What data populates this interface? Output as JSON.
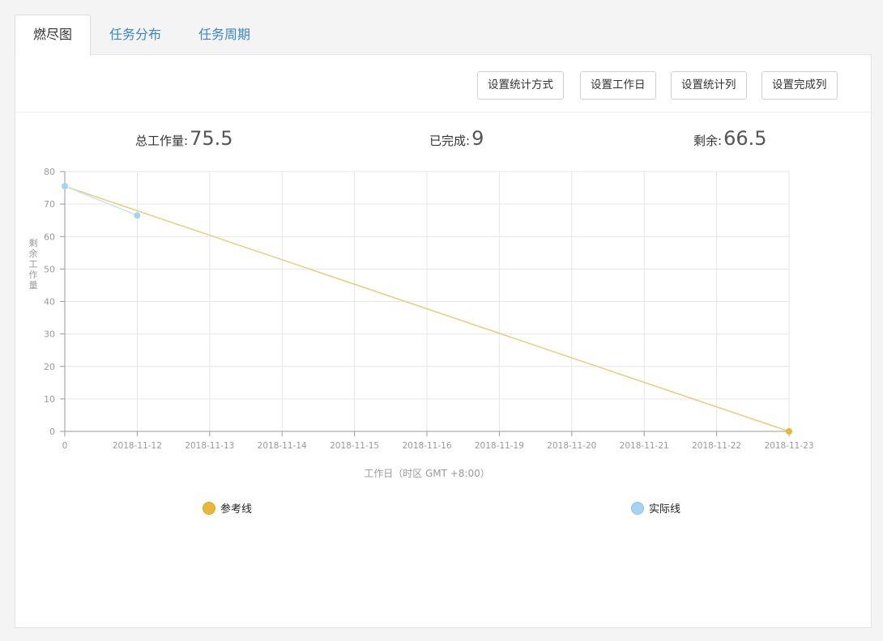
{
  "tabs": [
    {
      "label": "燃尽图",
      "active": true
    },
    {
      "label": "任务分布",
      "active": false
    },
    {
      "label": "任务周期",
      "active": false
    }
  ],
  "toolbar": {
    "stat_method": "设置统计方式",
    "workdays": "设置工作日",
    "stat_column": "设置统计列",
    "done_column": "设置完成列"
  },
  "summary": {
    "total_label": "总工作量:",
    "total_value": "75.5",
    "done_label": "已完成:",
    "done_value": "9",
    "remain_label": "剩余:",
    "remain_value": "66.5"
  },
  "colors": {
    "reference": "#e8cc7a",
    "reference_marker": "#e6b93a",
    "actual": "#a8d2ef",
    "actual_line": "#c9e3f5",
    "grid": "#e6e6e6",
    "axis": "#9a9a9a"
  },
  "chart_data": {
    "type": "line",
    "ylabel": "剩余工作量",
    "xlabel": "工作日（时区 GMT +8:00）",
    "categories": [
      "0",
      "2018-11-12",
      "2018-11-13",
      "2018-11-14",
      "2018-11-15",
      "2018-11-16",
      "2018-11-19",
      "2018-11-20",
      "2018-11-21",
      "2018-11-22",
      "2018-11-23"
    ],
    "ylim": [
      0,
      80
    ],
    "yticks": [
      0,
      10,
      20,
      30,
      40,
      50,
      60,
      70,
      80
    ],
    "grid": true,
    "legend_position": "bottom",
    "series": [
      {
        "name": "参考线",
        "values": [
          75.5,
          null,
          null,
          null,
          null,
          null,
          null,
          null,
          null,
          null,
          0
        ]
      },
      {
        "name": "实际线",
        "values": [
          75.5,
          66.5,
          null,
          null,
          null,
          null,
          null,
          null,
          null,
          null,
          null
        ]
      }
    ]
  }
}
